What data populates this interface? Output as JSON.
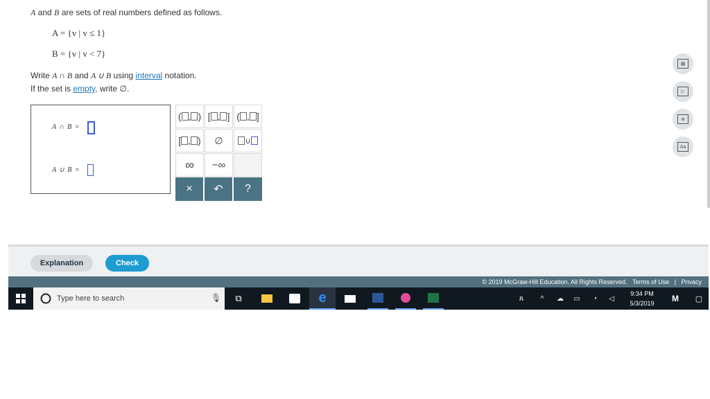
{
  "question": {
    "intro_a": "A",
    "intro_rest": " and ",
    "intro_b": "B",
    "intro_end": " are sets of real numbers defined as follows.",
    "set_a": "A = {v | v ≤ 1}",
    "set_b": "B = {v | v < 7}",
    "write_prefix": "Write ",
    "write_expr": "A ∩ B",
    "write_and": " and ",
    "write_expr2": "A ∪ B",
    "write_using": " using ",
    "interval_link": "interval",
    "write_suffix": " notation.",
    "empty_prefix": "If the set is ",
    "empty_link": "empty",
    "empty_suffix": ", write ∅."
  },
  "answers": {
    "intersection_label": "A ∩ B =",
    "union_label": "A ∪ B ="
  },
  "palette": {
    "infinity": "∞",
    "neg_infinity": "−∞",
    "empty_set": "∅",
    "union": "∪",
    "clear": "×",
    "undo": "↶",
    "help": "?"
  },
  "footer": {
    "explanation_label": "Explanation",
    "check_label": "Check",
    "copyright": "© 2019 McGraw-Hill Education. All Rights Reserved.",
    "terms": "Terms of Use",
    "sep": "|",
    "privacy": "Privacy"
  },
  "taskbar": {
    "search_placeholder": "Type here to search",
    "time": "9:34 PM",
    "date": "5/3/2019"
  },
  "colors": {
    "accent": "#1e9bd0",
    "palette_button": "#4a7384",
    "input_border": "#3b5bdb",
    "copyright_bar": "#52707f",
    "taskbar": "#101820"
  }
}
